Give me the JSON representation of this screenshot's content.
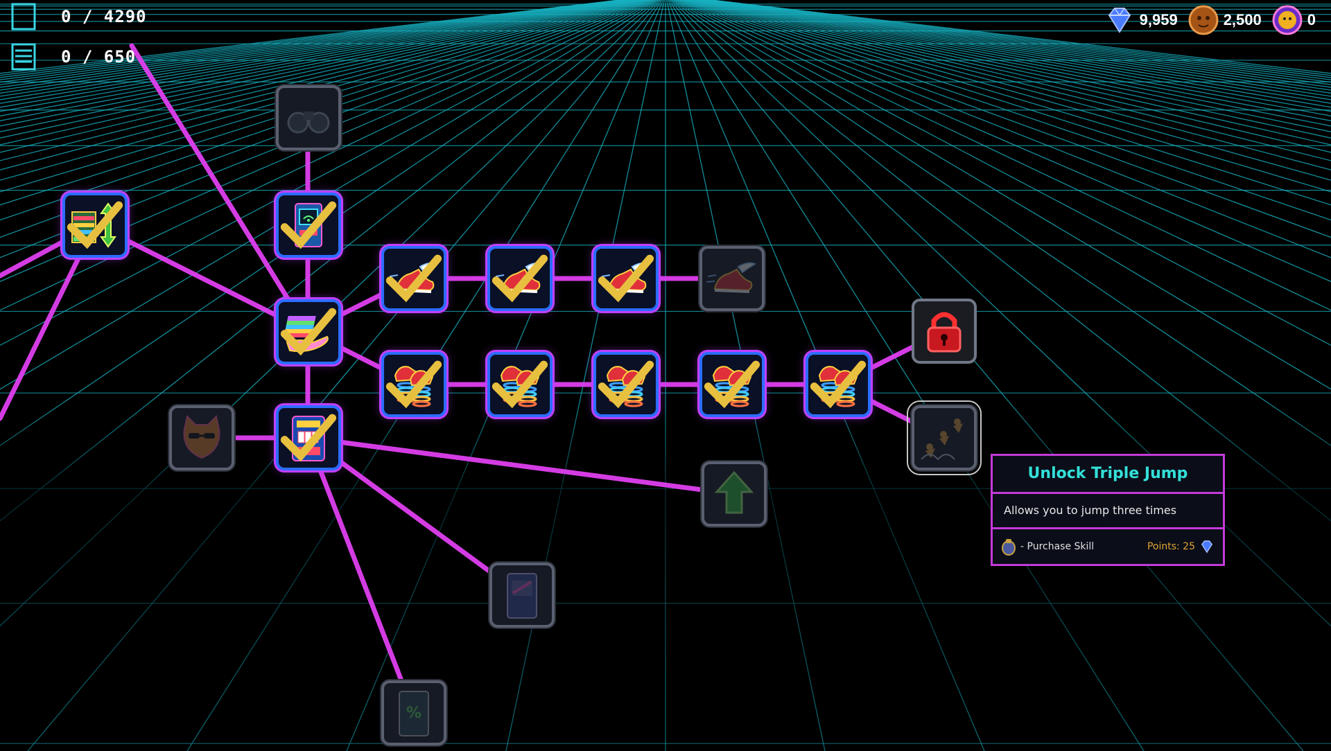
{
  "hud": {
    "progress_label": "0 / 4290",
    "progress_value": 0,
    "progress_max": 4290,
    "secondary_label": "0 / 650",
    "secondary_value": 0,
    "secondary_max": 650
  },
  "currencies": [
    {
      "icon": "diamond-gem-icon",
      "amount": "9,959",
      "color": "#4a7bff"
    },
    {
      "icon": "tiger-coin-icon",
      "amount": "2,500",
      "color": "#d07a2a"
    },
    {
      "icon": "rainbow-cat-coin-icon",
      "amount": "0",
      "color": "#b34cff"
    }
  ],
  "skill_nodes": [
    {
      "id": "n_binoculars",
      "icon": "binoculars-icon",
      "state": "locked"
    },
    {
      "id": "n_cash_updown",
      "icon": "cash-stack-updown-icon",
      "state": "owned"
    },
    {
      "id": "n_arcade_wifi",
      "icon": "arcade-wifi-icon",
      "state": "owned"
    },
    {
      "id": "n_cash_hand",
      "icon": "cash-hand-icon",
      "state": "owned"
    },
    {
      "id": "n_shoe1",
      "icon": "winged-shoe-icon",
      "state": "owned"
    },
    {
      "id": "n_shoe2",
      "icon": "winged-shoe-icon",
      "state": "owned"
    },
    {
      "id": "n_shoe3",
      "icon": "winged-shoe-icon",
      "state": "owned"
    },
    {
      "id": "n_shoe4",
      "icon": "winged-shoe-icon",
      "state": "locked"
    },
    {
      "id": "n_spring1",
      "icon": "spring-shoes-icon",
      "state": "owned"
    },
    {
      "id": "n_spring2",
      "icon": "spring-shoes-icon",
      "state": "owned"
    },
    {
      "id": "n_spring3",
      "icon": "spring-shoes-icon",
      "state": "owned"
    },
    {
      "id": "n_spring4",
      "icon": "spring-shoes-icon",
      "state": "owned"
    },
    {
      "id": "n_spring5",
      "icon": "spring-shoes-icon",
      "state": "owned"
    },
    {
      "id": "n_padlock",
      "icon": "padlock-icon",
      "state": "lock"
    },
    {
      "id": "n_triple_jump",
      "icon": "triple-jump-icon",
      "state": "locked"
    },
    {
      "id": "n_cat",
      "icon": "sunglasses-cat-icon",
      "state": "locked"
    },
    {
      "id": "n_slot",
      "icon": "slot-machine-icon",
      "state": "owned"
    },
    {
      "id": "n_upgrade",
      "icon": "upgrade-arrow-icon",
      "state": "locked"
    },
    {
      "id": "n_arcade2",
      "icon": "arcade-cabinet-icon",
      "state": "locked"
    },
    {
      "id": "n_discount",
      "icon": "discount-cabinet-icon",
      "state": "locked"
    }
  ],
  "tooltip": {
    "title": "Unlock Triple Jump",
    "description": "Allows you to jump three times",
    "action_icon": "purchase-coin-icon",
    "action_label": "- Purchase Skill",
    "points_label": "Points: 25",
    "points_icon": "diamond-gem-icon"
  },
  "colors": {
    "link": "#e040f0",
    "grid": "#17b0c0",
    "owned_border": "#2c6cff",
    "owned_glow": "#c040ff",
    "tooltip_title": "#33e0d8",
    "points": "#e2a532"
  }
}
